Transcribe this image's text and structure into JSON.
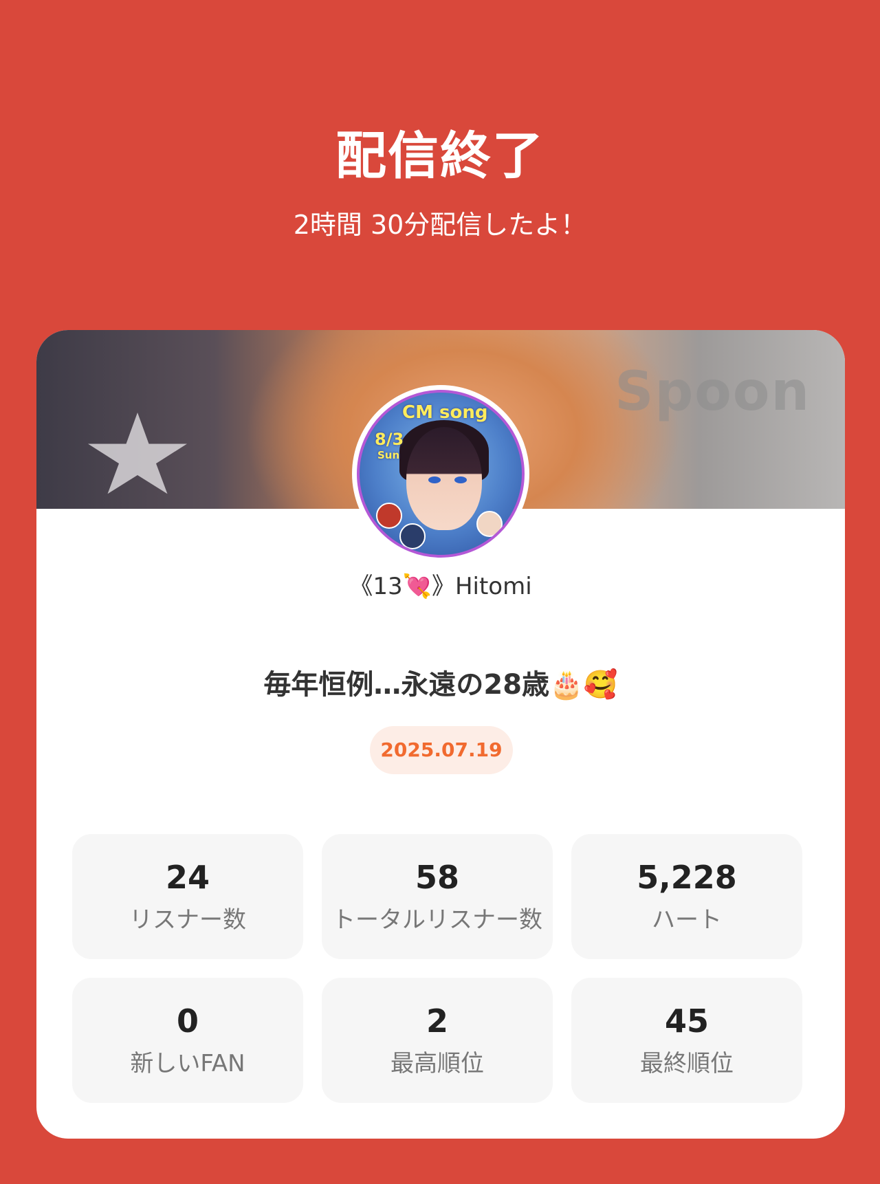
{
  "header": {
    "title": "配信終了",
    "subtitle": "2時間 30分配信したよ！"
  },
  "card": {
    "banner_watermark": "Spoon",
    "avatar_text": {
      "line1": "CM song",
      "line2": "8/3",
      "line3": "Sun"
    },
    "username": "《13💘》Hitomi",
    "stream_title": "毎年恒例…永遠の28歳🎂🥰",
    "date": "2025.07.19"
  },
  "stats": [
    {
      "value": "24",
      "label": "リスナー数"
    },
    {
      "value": "58",
      "label": "トータルリスナー数"
    },
    {
      "value": "5,228",
      "label": "ハート"
    },
    {
      "value": "0",
      "label": "新しいFAN"
    },
    {
      "value": "2",
      "label": "最高順位"
    },
    {
      "value": "45",
      "label": "最終順位"
    }
  ],
  "colors": {
    "background": "#D9483B",
    "card": "#FFFFFF",
    "stat_tile": "#F6F6F6",
    "date_badge_bg": "#FDEDE6",
    "date_badge_text": "#F16A2F"
  }
}
